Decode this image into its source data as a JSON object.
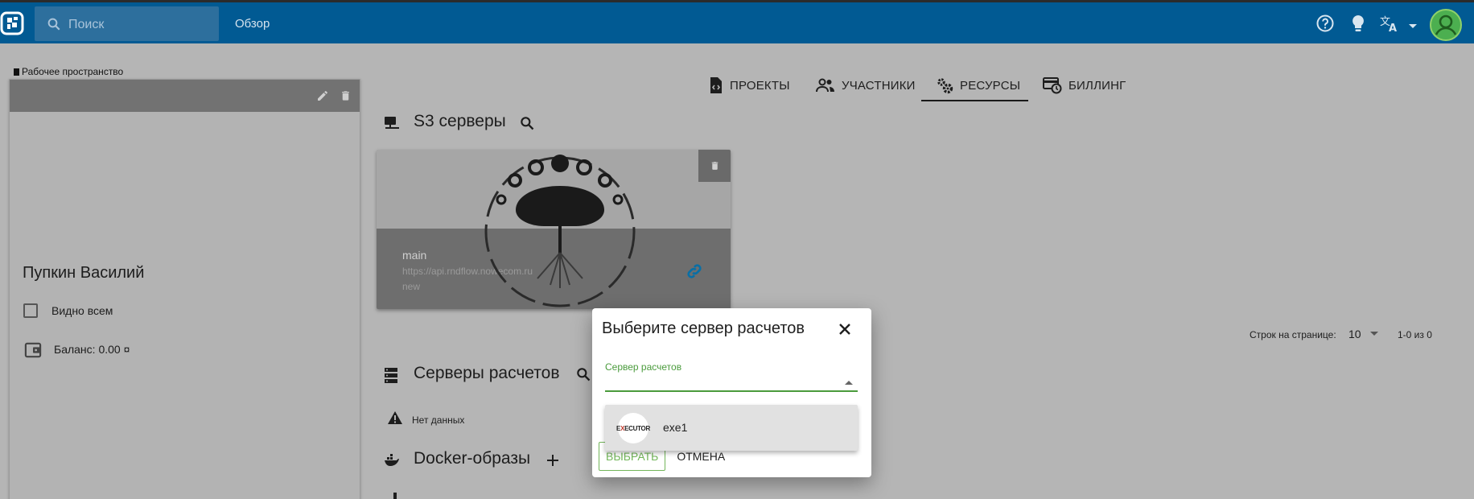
{
  "topbar": {
    "search_placeholder": "Поиск",
    "overview_label": "Обзор"
  },
  "workspace": {
    "label": "Рабочее пространство",
    "user_name": "Пупкин Василий",
    "visible_label": "Видно всем",
    "balance_label": "Баланс: 0.00 ¤"
  },
  "tabs": [
    {
      "label": "ПРОЕКТЫ",
      "icon": "file-code-icon"
    },
    {
      "label": "УЧАСТНИКИ",
      "icon": "people-icon"
    },
    {
      "label": "РЕСУРСЫ",
      "icon": "gears-icon",
      "active": true
    },
    {
      "label": "БИЛЛИНГ",
      "icon": "billing-icon"
    }
  ],
  "s3": {
    "title": "S3 серверы",
    "card": {
      "name": "main",
      "url": "https://api.rndflow.nowecom.ru",
      "status": "new"
    },
    "pagination": {
      "rows_label": "Строк на странице:",
      "rows_value": "10",
      "range": "1-0 из 0"
    }
  },
  "compute": {
    "title": "Серверы расчетов",
    "no_data": "Нет данных"
  },
  "docker": {
    "title": "Docker-образы"
  },
  "dialog": {
    "title": "Выберите сервер расчетов",
    "field_label": "Сервер расчетов",
    "option_label": "exe1",
    "option_logo_text_a": "E",
    "option_logo_text_b": "X",
    "option_logo_text_c": "ECUTOR",
    "ok_label": "ВЫБРАТЬ",
    "cancel_label": "ОТМЕНА"
  },
  "colors": {
    "topbar": "#015a93",
    "accent_green": "#4a9b3c",
    "overlay": "#b5b5b5"
  }
}
